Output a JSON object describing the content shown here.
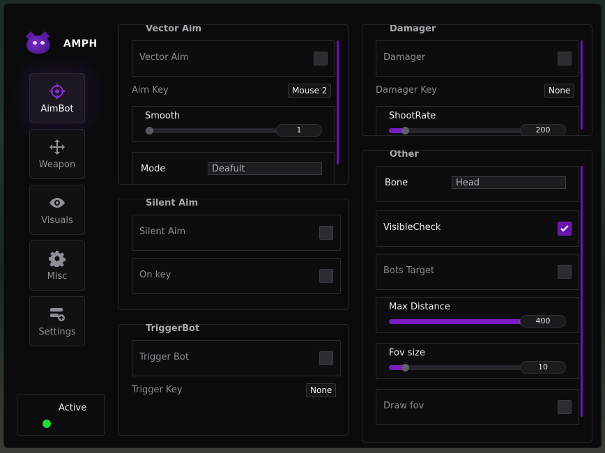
{
  "app": {
    "title": "AMPH",
    "accent": "#6a13ad"
  },
  "sidebar": {
    "items": [
      {
        "label": "AimBot",
        "icon": "crosshair-icon",
        "active": true
      },
      {
        "label": "Weapon",
        "icon": "move-arrows-icon",
        "active": false
      },
      {
        "label": "Visuals",
        "icon": "eye-icon",
        "active": false
      },
      {
        "label": "Misc",
        "icon": "gear-icon",
        "active": false
      },
      {
        "label": "Settings",
        "icon": "settings-sliders-icon",
        "active": false
      }
    ],
    "status": {
      "label": "Active",
      "color": "#22dd33"
    }
  },
  "vector_aim": {
    "title": "Vector Aim",
    "toggle_label": "Vector Aim",
    "toggle_checked": false,
    "key_label": "Aim Key",
    "key_value": "Mouse 2",
    "smooth": {
      "label": "Smooth",
      "value": "1",
      "fraction": 0.0
    },
    "mode": {
      "label": "Mode",
      "value": "Deafult"
    }
  },
  "silent_aim": {
    "title": "Silent Aim",
    "toggle_label": "Silent Aim",
    "toggle_checked": false,
    "on_key_label": "On key",
    "on_key_checked": false
  },
  "triggerbot": {
    "title": "TriggerBot",
    "toggle_label": "Trigger Bot",
    "toggle_checked": false,
    "key_label": "Trigger Key",
    "key_value": "None"
  },
  "damager": {
    "title": "Damager",
    "toggle_label": "Damager",
    "toggle_checked": false,
    "key_label": "Damager Key",
    "key_value": "None",
    "shootrate": {
      "label": "ShootRate",
      "value": "200",
      "fraction": 0.09
    }
  },
  "other": {
    "title": "Other",
    "bone": {
      "label": "Bone",
      "value": "Head"
    },
    "visible_check": {
      "label": "VisibleCheck",
      "checked": true
    },
    "bots_target": {
      "label": "Bots Target",
      "checked": false
    },
    "max_distance": {
      "label": "Max Distance",
      "value": "400",
      "fraction": 0.97
    },
    "fov_size": {
      "label": "Fov size",
      "value": "10",
      "fraction": 0.09
    },
    "draw_fov": {
      "label": "Draw fov",
      "checked": false
    }
  }
}
